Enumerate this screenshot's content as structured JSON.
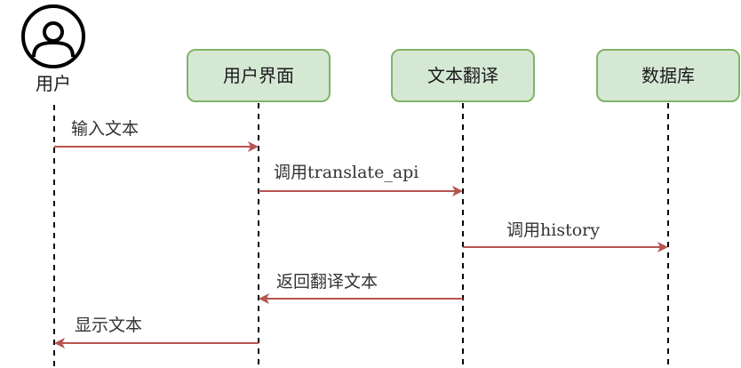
{
  "actor": {
    "label": "用户",
    "icon": "user-icon"
  },
  "participants": [
    {
      "id": "ui",
      "label": "用户界面"
    },
    {
      "id": "translate",
      "label": "文本翻译"
    },
    {
      "id": "db",
      "label": "数据库"
    }
  ],
  "messages": [
    {
      "label": "输入文本",
      "from": "actor",
      "to": "ui"
    },
    {
      "label": "调用translate_api",
      "from": "ui",
      "to": "translate"
    },
    {
      "label": "调用history",
      "from": "translate",
      "to": "db"
    },
    {
      "label": "返回翻译文本",
      "from": "translate",
      "to": "ui"
    },
    {
      "label": "显示文本",
      "from": "ui",
      "to": "actor"
    }
  ],
  "colors": {
    "box_fill": "#d5e8d4",
    "box_stroke": "#82b366",
    "arrow": "#b85450",
    "lifeline": "#000000",
    "text": "#333333"
  }
}
